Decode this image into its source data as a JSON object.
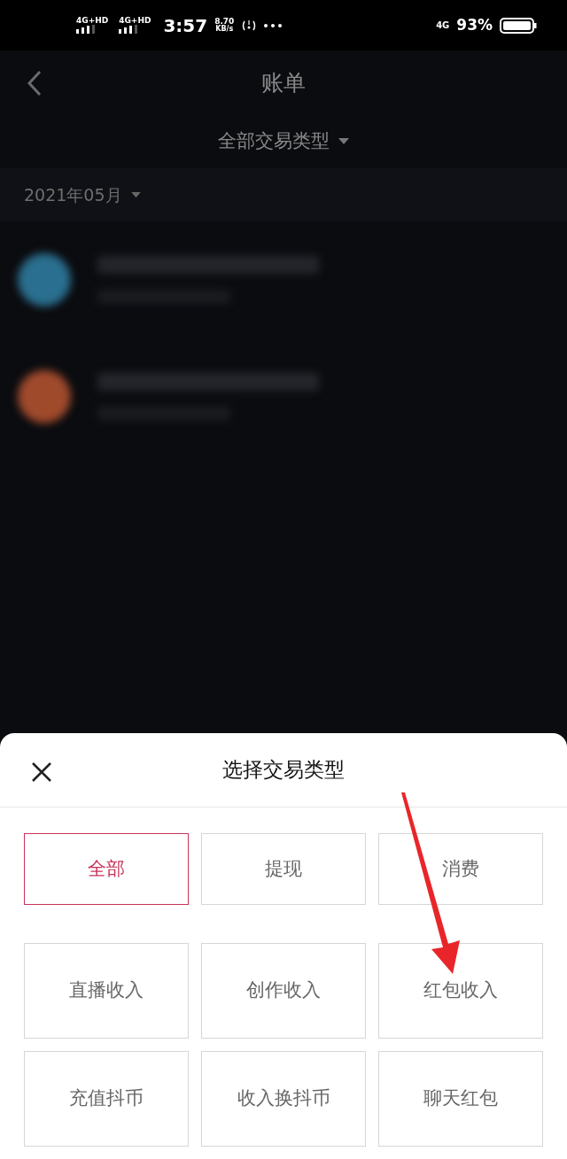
{
  "status_bar": {
    "sims": [
      {
        "label": "4G+HD"
      },
      {
        "label": "4G+HD"
      }
    ],
    "time": "3:57",
    "speed_value": "8.70",
    "speed_unit": "KB/s",
    "network": "4G",
    "battery": "93%"
  },
  "header": {
    "title": "账单"
  },
  "filter": {
    "label": "全部交易类型"
  },
  "month": {
    "label": "2021年05月"
  },
  "records": [
    {
      "color": "#2a6f8f"
    },
    {
      "color": "#a04a2c"
    }
  ],
  "sheet": {
    "title": "选择交易类型",
    "options": [
      [
        {
          "label": "全部",
          "selected": true
        },
        {
          "label": "提现",
          "selected": false
        },
        {
          "label": "消费",
          "selected": false
        }
      ],
      [
        {
          "label": "直播收入",
          "selected": false
        },
        {
          "label": "创作收入",
          "selected": false
        },
        {
          "label": "红包收入",
          "selected": false
        }
      ],
      [
        {
          "label": "充值抖币",
          "selected": false
        },
        {
          "label": "收入换抖币",
          "selected": false
        },
        {
          "label": "聊天红包",
          "selected": false
        }
      ]
    ]
  }
}
